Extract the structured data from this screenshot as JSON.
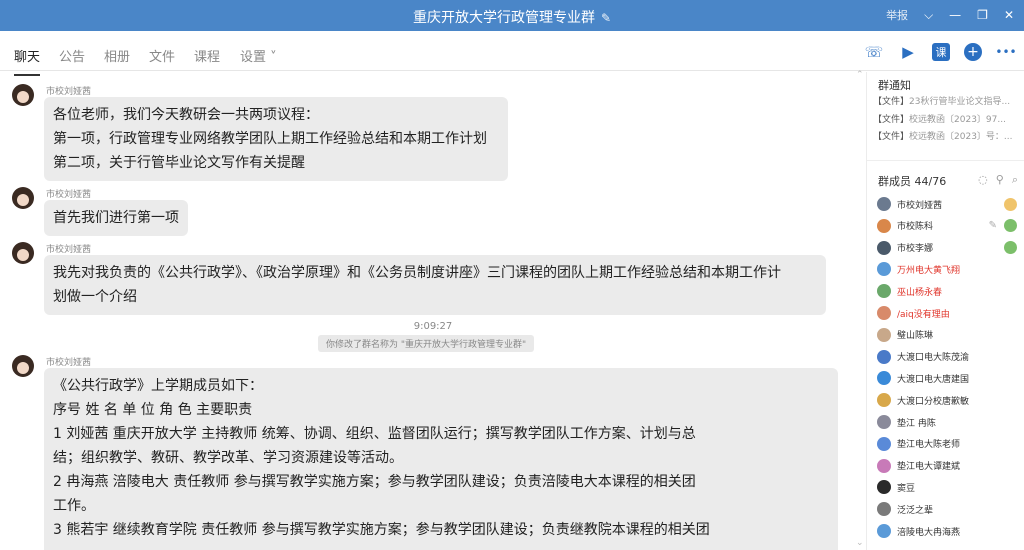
{
  "window": {
    "title": "重庆开放大学行政管理专业群",
    "edit_icon": "edit-icon",
    "report_label": "举报",
    "controls": [
      "chevron-down-icon",
      "minimize-icon",
      "restore-icon",
      "close-icon"
    ]
  },
  "tabs": [
    {
      "label": "聊天"
    },
    {
      "label": "公告"
    },
    {
      "label": "相册"
    },
    {
      "label": "文件"
    },
    {
      "label": "课程"
    },
    {
      "label": "设置 ˅"
    }
  ],
  "toolbar": {
    "call": "phone-icon",
    "video": "video-icon",
    "course": "课",
    "add": "+",
    "more": "•••"
  },
  "messages": [
    {
      "sender": "市校刘娅茜",
      "lines": [
        "各位老师，我们今天教研会一共两项议程：",
        "第一项，行政管理专业网络教学团队上期工作经验总结和本期工作计划",
        "第二项，关于行管毕业论文写作有关提醒"
      ]
    },
    {
      "sender": "市校刘娅茜",
      "lines": [
        "首先我们进行第一项"
      ]
    },
    {
      "sender": "市校刘娅茜",
      "lines": [
        "我先对我负责的《公共行政学》、《政治学原理》和《公务员制度讲座》三门课程的团队上期工作经验总结和本期工作计",
        "划做一个介绍"
      ]
    },
    {
      "sender": "市校刘娅茜",
      "lines": [
        "《公共行政学》上学期成员如下：",
        "序号      姓 名       单 位       角 色       主要职责",
        "1       刘娅茜       重庆开放大学       主持教师       统筹、协调、组织、监督团队运行；撰写教学团队工作方案、计划与总",
        "结；组织教学、教研、教学改革、学习资源建设等活动。",
        "2       冉海燕       涪陵电大       责任教师       参与撰写教学实施方案；参与教学团队建设；负责涪陵电大本课程的相关团",
        "工作。",
        "3       熊若宇       继续教育学院       责任教师       参与撰写教学实施方案；参与教学团队建设；负责继教院本课程的相关团"
      ]
    }
  ],
  "system": {
    "time": "9:09:27",
    "note": "你修改了群名称为 \"重庆开放大学行政管理专业群\""
  },
  "notice": {
    "title": "群通知",
    "items": [
      {
        "tag": "【文件】",
        "text": "23秋行管毕业论文指导..."
      },
      {
        "tag": "【文件】",
        "text": "校远教函〔2023〕97..."
      },
      {
        "tag": "【文件】",
        "text": "校远教函〔2023〕号：..."
      }
    ]
  },
  "members": {
    "title": "群成员 44/76",
    "list": [
      {
        "name": "市校刘娅茜",
        "red": false,
        "badge": "owner"
      },
      {
        "name": "市校陈科",
        "red": false,
        "badge": "admin"
      },
      {
        "name": "市校李娜",
        "red": false,
        "badge": "admin"
      },
      {
        "name": "万州电大黄飞翔",
        "red": true,
        "badge": ""
      },
      {
        "name": "巫山杨永春",
        "red": true,
        "badge": ""
      },
      {
        "name": "/aiq没有理由",
        "red": true,
        "badge": ""
      },
      {
        "name": "璧山陈琳",
        "red": false,
        "badge": ""
      },
      {
        "name": "大渡口电大陈茂渝",
        "red": false,
        "badge": ""
      },
      {
        "name": "大渡口电大唐建国",
        "red": false,
        "badge": ""
      },
      {
        "name": "大渡口分校唐歉敏",
        "red": false,
        "badge": ""
      },
      {
        "name": "垫江 冉陈",
        "red": false,
        "badge": ""
      },
      {
        "name": "垫江电大陈老师",
        "red": false,
        "badge": ""
      },
      {
        "name": "垫江电大谭建斌",
        "red": false,
        "badge": ""
      },
      {
        "name": "窦豆",
        "red": false,
        "badge": ""
      },
      {
        "name": "泛泛之辈",
        "red": false,
        "badge": ""
      },
      {
        "name": "涪陵电大冉海燕",
        "red": false,
        "badge": ""
      }
    ]
  }
}
